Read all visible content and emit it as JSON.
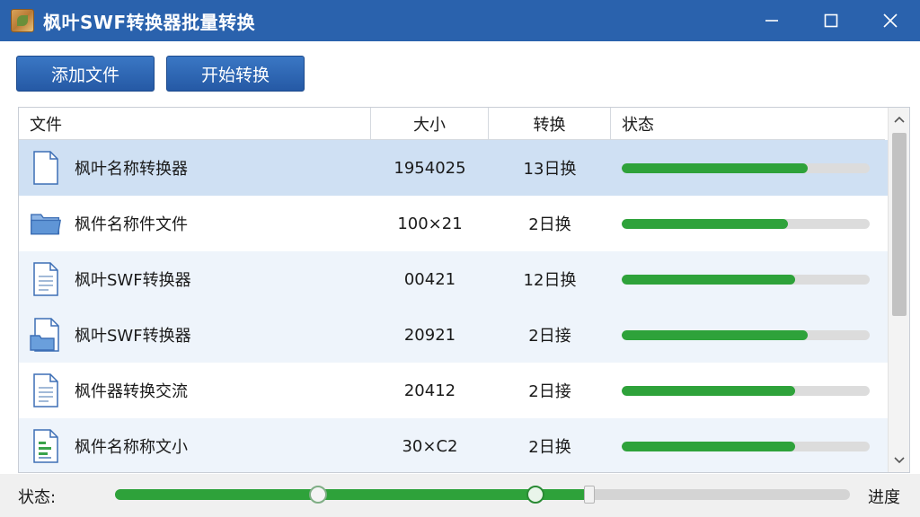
{
  "window": {
    "title": "枫叶SWF转换器批量转换",
    "icon": "maple-leaf-app-icon"
  },
  "toolbar": {
    "add_label": "添加文件",
    "start_label": "开始转换"
  },
  "table": {
    "headers": [
      "文件",
      "大小",
      "转换",
      "状态"
    ],
    "rows": [
      {
        "icon": "document-icon",
        "name": "枫叶名称转换器",
        "size": "1954025",
        "conv": "13日换",
        "progress": 0.75,
        "selected": true
      },
      {
        "icon": "folder-icon",
        "name": "枫件名称件文件",
        "size": "100×21",
        "conv": "2日换",
        "progress": 0.67
      },
      {
        "icon": "document-icon",
        "name": "枫叶SWF转换器",
        "size": "00421",
        "conv": "12日换",
        "progress": 0.7
      },
      {
        "icon": "document-folder-icon",
        "name": "枫叶SWF转换器",
        "size": "20921",
        "conv": "2日接",
        "progress": 0.75
      },
      {
        "icon": "document-icon",
        "name": "枫件器转换交流",
        "size": "20412",
        "conv": "2日接",
        "progress": 0.7
      },
      {
        "icon": "spreadsheet-icon",
        "name": "枫件名称称文小",
        "size": "30×C2",
        "conv": "2日换",
        "progress": 0.7
      }
    ]
  },
  "statusbar": {
    "label": "状态:",
    "right_label": "进度",
    "progress": 0.64
  },
  "colors": {
    "titlebar": "#2a62ad",
    "button": "#2559a5",
    "progress": "#2ea23a",
    "selected_row": "#cfe0f3"
  }
}
